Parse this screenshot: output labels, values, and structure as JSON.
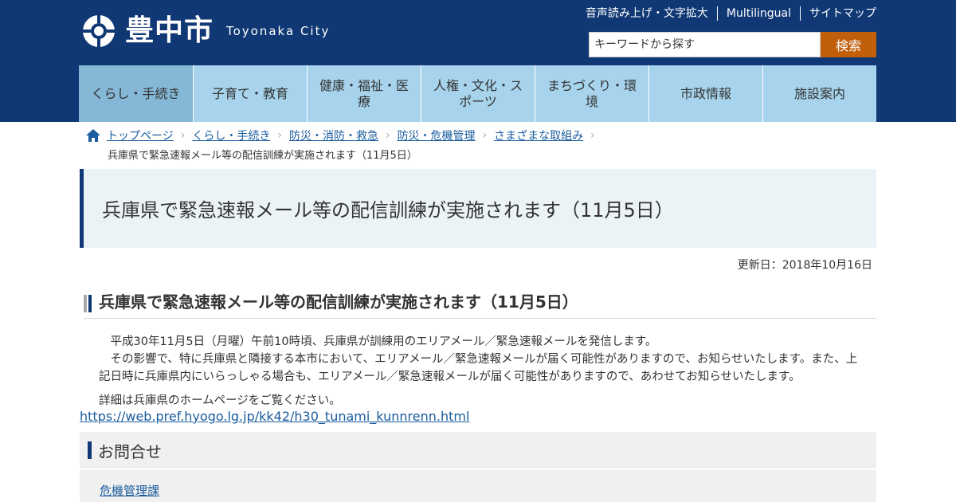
{
  "header": {
    "city_name": "豊中市",
    "city_name_en": "Toyonaka City",
    "util_links": [
      "音声読み上げ・文字拡大",
      "Multilingual",
      "サイトマップ"
    ],
    "search": {
      "placeholder": "キーワードから探す",
      "button_label": "検索"
    }
  },
  "nav": {
    "items": [
      "くらし・手続き",
      "子育て・教育",
      "健康・福祉・医療",
      "人権・文化・スポーツ",
      "まちづくり・環境",
      "市政情報",
      "施設案内"
    ]
  },
  "breadcrumb": {
    "items": [
      "トップページ",
      "くらし・手続き",
      "防災・消防・救急",
      "防災・危機管理",
      "さまざまな取組み"
    ],
    "current": "兵庫県で緊急速報メール等の配信訓練が実施されます（11月5日）"
  },
  "page": {
    "title": "兵庫県で緊急速報メール等の配信訓練が実施されます（11月5日）",
    "updated": "更新日：2018年10月16日",
    "section_heading": "兵庫県で緊急速報メール等の配信訓練が実施されます（11月5日）",
    "paragraph1": "平成30年11月5日（月曜）午前10時頃、兵庫県が訓練用のエリアメール／緊急速報メールを発信します。",
    "paragraph2": "その影響で、特に兵庫県と隣接する本市において、エリアメール／緊急速報メールが届く可能性がありますので、お知らせいたします。また、上記日時に兵庫県内にいらっしゃる場合も、エリアメール／緊急速報メールが届く可能性がありますので、あわせてお知らせいたします。",
    "detail_text": "詳細は兵庫県のホームページをご覧ください。",
    "link": "https://web.pref.hyogo.lg.jp/kk42/h30_tunami_kunnrenn.html"
  },
  "contact": {
    "heading": "お問合せ",
    "department": "危機管理課"
  },
  "colors": {
    "header_bg": "#0f3874",
    "nav_bg": "#a7d4ec",
    "nav_active_bg": "#85b7d6",
    "search_button": "#c15f0b",
    "link": "#1a5c9e"
  }
}
